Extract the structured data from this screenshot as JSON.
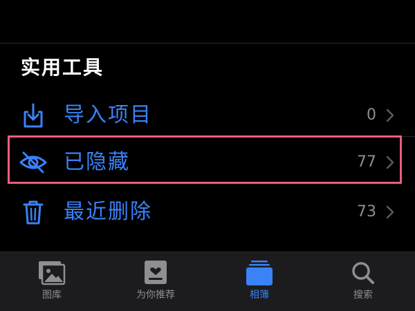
{
  "section": {
    "title": "实用工具"
  },
  "rows": [
    {
      "icon": "import-icon",
      "label": "导入项目",
      "count": "0"
    },
    {
      "icon": "eye-slash-icon",
      "label": "已隐藏",
      "count": "77"
    },
    {
      "icon": "trash-icon",
      "label": "最近删除",
      "count": "73"
    }
  ],
  "tabbar": {
    "tabs": [
      {
        "icon": "photos-library-icon",
        "label": "图库",
        "active": false
      },
      {
        "icon": "for-you-icon",
        "label": "为你推荐",
        "active": false
      },
      {
        "icon": "albums-icon",
        "label": "相簿",
        "active": true
      },
      {
        "icon": "search-icon",
        "label": "搜索",
        "active": false
      }
    ]
  },
  "colors": {
    "accent": "#3a82f7",
    "background": "#000000",
    "tabbar_bg": "#1c1c1e",
    "highlight": "#e8607c",
    "secondary_text": "#8e8e93"
  }
}
